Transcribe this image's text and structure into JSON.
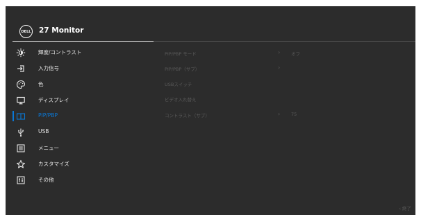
{
  "header": {
    "logo_text": "DELL",
    "title": "27 Monitor"
  },
  "menu": {
    "items": [
      {
        "label": "輝度/コントラスト",
        "icon": "brightness-icon"
      },
      {
        "label": "入力信号",
        "icon": "input-source-icon"
      },
      {
        "label": "色",
        "icon": "color-palette-icon"
      },
      {
        "label": "ディスプレイ",
        "icon": "display-icon"
      },
      {
        "label": "PIP/PBP",
        "icon": "pip-pbp-icon",
        "active": true
      },
      {
        "label": "USB",
        "icon": "usb-icon"
      },
      {
        "label": "メニュー",
        "icon": "menu-icon"
      },
      {
        "label": "カスタマイズ",
        "icon": "star-icon"
      },
      {
        "label": "その他",
        "icon": "others-icon"
      }
    ]
  },
  "submenu": {
    "items": [
      {
        "label": "PIP/PBP モード",
        "arrow": "›",
        "value": "オフ"
      },
      {
        "label": "PIP/PBP（サブ）",
        "arrow": "›",
        "value": ""
      },
      {
        "label": "USBスイッチ",
        "arrow": "",
        "value": ""
      },
      {
        "label": "ビデオ入れ替え",
        "arrow": "",
        "value": ""
      },
      {
        "label": "コントラスト（サブ）",
        "arrow": "›",
        "value": "75"
      }
    ]
  },
  "footer": {
    "exit_label": "‹ 終了"
  },
  "colors": {
    "background": "#2c2c2c",
    "accent": "#0a78d6",
    "text": "#e6e6e6",
    "disabled": "#5a5a5a"
  }
}
